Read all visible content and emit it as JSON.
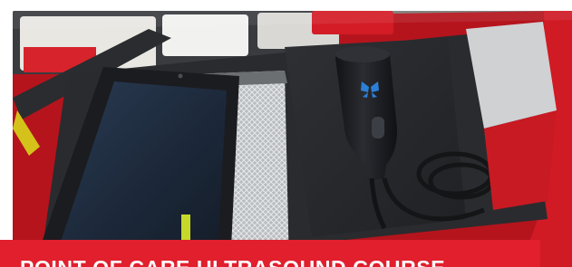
{
  "banner": {
    "title": "POINT OF CARE ULTRASOUND COURSE"
  },
  "photo": {
    "subject": "ultrasound-probe-in-medical-bag",
    "colors": {
      "bag_red": "#c41620",
      "probe_black": "#1c1d21",
      "logo_blue": "#2b7fd6",
      "tablet_frame": "#1b1c20",
      "tablet_screen": "#1d2a3c",
      "banner_red": "#e11f2d"
    }
  }
}
